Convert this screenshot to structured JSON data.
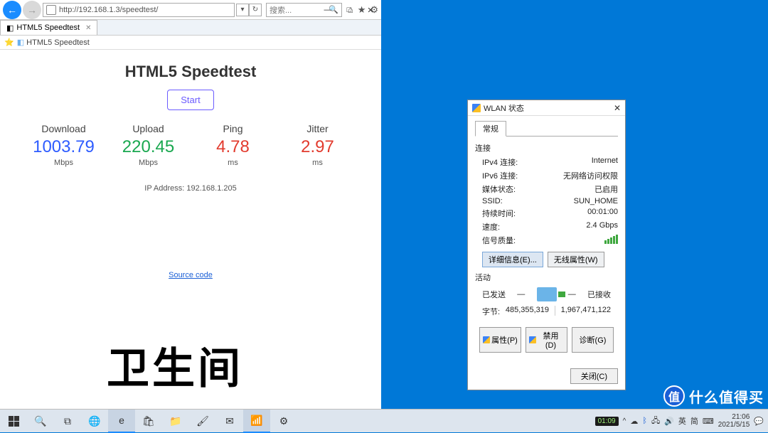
{
  "ie": {
    "url": "http://192.168.1.3/speedtest/",
    "search_placeholder": "搜索...",
    "tab_title": "HTML5 Speedtest",
    "fav_label": "HTML5 Speedtest",
    "sys": {
      "min": "—",
      "max": "□",
      "close": "✕"
    }
  },
  "page": {
    "title": "HTML5 Speedtest",
    "start": "Start",
    "metrics": [
      {
        "label": "Download",
        "value": "1003.79",
        "unit": "Mbps",
        "cls": "v-blue"
      },
      {
        "label": "Upload",
        "value": "220.45",
        "unit": "Mbps",
        "cls": "v-green"
      },
      {
        "label": "Ping",
        "value": "4.78",
        "unit": "ms",
        "cls": "v-red"
      },
      {
        "label": "Jitter",
        "value": "2.97",
        "unit": "ms",
        "cls": "v-red"
      }
    ],
    "ip_label": "IP Address: 192.168.1.205",
    "source_link": "Source code"
  },
  "handwrite": "卫生间",
  "wlan": {
    "title": "WLAN 状态",
    "tab": "常规",
    "section_conn": "连接",
    "rows": [
      {
        "k": "IPv4 连接:",
        "v": "Internet"
      },
      {
        "k": "IPv6 连接:",
        "v": "无网络访问权限"
      },
      {
        "k": "媒体状态:",
        "v": "已启用"
      },
      {
        "k": "SSID:",
        "v": "SUN_HOME"
      },
      {
        "k": "持续时间:",
        "v": "00:01:00"
      },
      {
        "k": "速度:",
        "v": "2.4 Gbps"
      },
      {
        "k": "信号质量:",
        "v": ""
      }
    ],
    "btn_detail": "详细信息(E)...",
    "btn_wireless": "无线属性(W)",
    "section_act": "活动",
    "sent_label": "已发送",
    "recv_label": "已接收",
    "bytes_label": "字节:",
    "bytes_sent": "485,355,319",
    "bytes_recv": "1,967,471,122",
    "btn_prop": "属性(P)",
    "btn_disable": "禁用(D)",
    "btn_diag": "诊断(G)",
    "btn_close": "关闭(C)"
  },
  "taskbar": {
    "time": "21:06",
    "date": "2021/5/15",
    "ime1": "英",
    "ime2": "简",
    "badge": "01:09",
    "caret": "^"
  },
  "watermark": {
    "mark": "值",
    "text": "什么值得买"
  }
}
